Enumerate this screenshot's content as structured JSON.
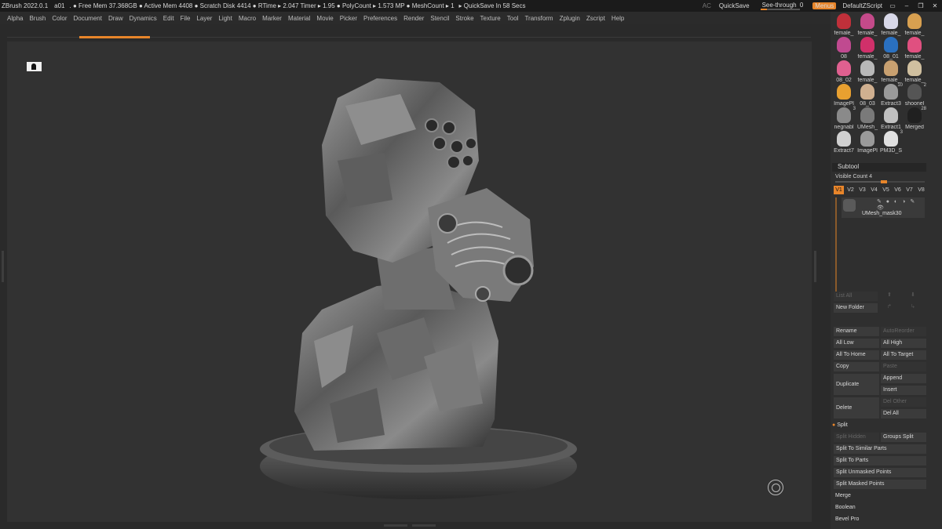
{
  "titlebar": {
    "app": "ZBrush 2022.0.1",
    "doc": "a01",
    "stats": ". ● Free Mem 37.368GB ● Active Mem 4408 ● Scratch Disk 4414 ● RTime ▸ 2.047 Timer ▸ 1.95 ● PolyCount ▸ 1.573 MP ● MeshCount ▸ 1",
    "quicksave_timer": "▸ QuickSave In 58 Secs",
    "ac": "AC",
    "quicksave": "QuickSave",
    "see_through": "See-through",
    "see_through_value": "0",
    "menus": "Menus",
    "script": "DefaultZScript"
  },
  "menu": [
    "Alpha",
    "Brush",
    "Color",
    "Document",
    "Draw",
    "Dynamics",
    "Edit",
    "File",
    "Layer",
    "Light",
    "Macro",
    "Marker",
    "Material",
    "Movie",
    "Picker",
    "Preferences",
    "Render",
    "Stencil",
    "Stroke",
    "Texture",
    "Tool",
    "Transform",
    "Zplugin",
    "Zscript",
    "Help"
  ],
  "tools": [
    {
      "label": "female_",
      "color": "#c0303a",
      "count": ""
    },
    {
      "label": "female_",
      "color": "#c44a8a",
      "count": ""
    },
    {
      "label": "female_",
      "color": "#d8d8e8",
      "count": ""
    },
    {
      "label": "female_",
      "color": "#d8a050",
      "count": ""
    },
    {
      "label": "08",
      "color": "#c04a90",
      "count": ""
    },
    {
      "label": "female_",
      "color": "#d0306a",
      "count": ""
    },
    {
      "label": "08_01",
      "color": "#2a70c0",
      "count": ""
    },
    {
      "label": "female_",
      "color": "#e05080",
      "count": ""
    },
    {
      "label": "08_02",
      "color": "#e06090",
      "count": ""
    },
    {
      "label": "female_",
      "color": "#b8b8b8",
      "count": ""
    },
    {
      "label": "female_",
      "color": "#c8a070",
      "count": ""
    },
    {
      "label": "female_",
      "color": "#d0c0a0",
      "count": ""
    },
    {
      "label": "ImagePl",
      "color": "#e8a030",
      "count": ""
    },
    {
      "label": "08_03",
      "color": "#d0b090",
      "count": ""
    },
    {
      "label": "Extract3",
      "color": "#9a9a9a",
      "count": "10"
    },
    {
      "label": "shoonel",
      "color": "#555555",
      "count": "2"
    },
    {
      "label": "negnabl",
      "color": "#8a8a8a",
      "count": "3"
    },
    {
      "label": "UMesh_",
      "color": "#7a7a7a",
      "count": ""
    },
    {
      "label": "Extract1",
      "color": "#c0c0c0",
      "count": ""
    },
    {
      "label": "Merged",
      "color": "#202020",
      "count": "28"
    },
    {
      "label": "Extract7",
      "color": "#d0d0d0",
      "count": ""
    },
    {
      "label": "ImagePl",
      "color": "#9a9a9a",
      "count": ""
    },
    {
      "label": "PM3D_S",
      "color": "#e0e0e0",
      "count": "3"
    }
  ],
  "subtool": {
    "title": "Subtool",
    "visible_count": "Visible Count 4",
    "visible_count_level": 0.5,
    "versions": [
      "V1",
      "V2",
      "V3",
      "V4",
      "V5",
      "V6",
      "V7",
      "V8"
    ],
    "item_name": "UMesh_mask30",
    "list_all": "List All",
    "new_folder": "New Folder",
    "rename": "Rename",
    "autoreorder": "AutoReorder",
    "all_low": "All Low",
    "all_high": "All High",
    "all_to_home": "All To Home",
    "all_to_target": "All To Target",
    "copy": "Copy",
    "paste": "Paste",
    "append": "Append",
    "duplicate": "Duplicate",
    "insert": "Insert",
    "delete": "Delete",
    "del_other": "Del Other",
    "del_all": "Del All",
    "split": "Split",
    "split_hidden": "Split Hidden",
    "groups_split": "Groups Split",
    "split_similar": "Split To Similar Parts",
    "split_parts": "Split To Parts",
    "split_unmasked": "Split Unmasked Points",
    "split_masked": "Split Masked Points",
    "merge": "Merge",
    "boolean": "Boolean",
    "bevel_pro": "Bevel Pro"
  },
  "accent": "#e8852a"
}
